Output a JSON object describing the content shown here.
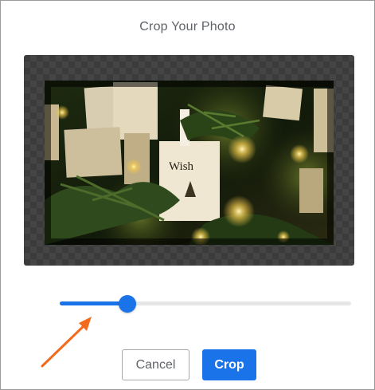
{
  "dialog": {
    "title": "Crop Your Photo"
  },
  "photo": {
    "tag_text": "Wish",
    "description": "christmas tree tags photo"
  },
  "zoom_slider": {
    "value_fraction": 0.13
  },
  "buttons": {
    "cancel_label": "Cancel",
    "crop_label": "Crop"
  },
  "colors": {
    "accent": "#1a73e8",
    "annotation_arrow": "#f26b1d",
    "crop_background": "#3b3b3b"
  }
}
